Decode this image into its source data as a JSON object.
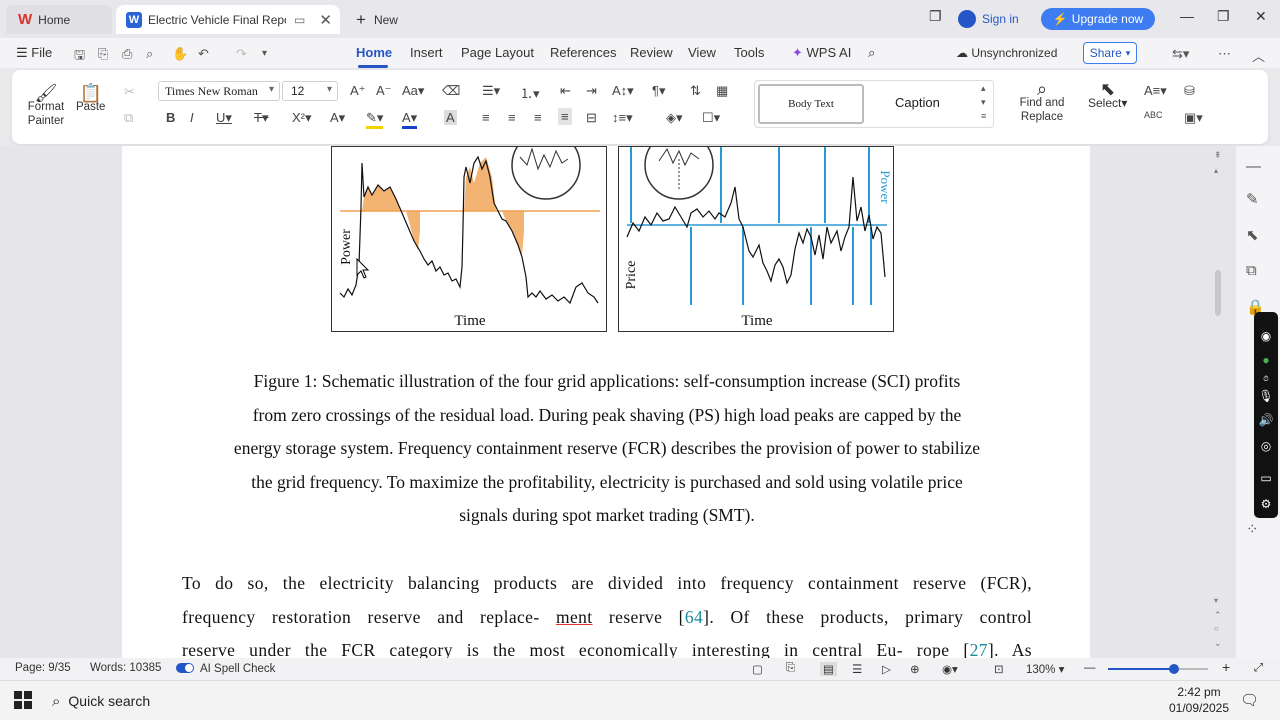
{
  "tabs": {
    "home": "Home",
    "document": "Electric Vehicle Final Report...",
    "new": "New"
  },
  "titlebar": {
    "sign_in": "Sign in",
    "upgrade": "Upgrade now"
  },
  "menu": {
    "file": "File",
    "items": [
      "Home",
      "Insert",
      "Page Layout",
      "References",
      "Review",
      "View",
      "Tools"
    ],
    "wps_ai": "WPS AI",
    "sync_status": "Unsynchronized",
    "share": "Share"
  },
  "ribbon": {
    "format_painter": "Format Painter",
    "paste": "Paste",
    "font_name": "Times New Roman",
    "font_size": "12",
    "styles": {
      "body_text": "Body Text",
      "caption": "Caption"
    },
    "find_replace": "Find and Replace",
    "select": "Select"
  },
  "figure": {
    "left_ylabel": "Power",
    "left_xlabel": "Time",
    "right_ylabel": "Price",
    "right_xlabel": "Time",
    "right_corner_label": "Power"
  },
  "document": {
    "caption_lines": [
      "Figure 1: Schematic illustration of the four grid applications: self-consumption increase (SCI) profits",
      "from zero crossings of the residual load. During peak shaving (PS) high load peaks are capped by the",
      "energy storage system. Frequency containment reserve (FCR) describes the provision of power to stabilize",
      "the grid frequency. To maximize the profitability, electricity is purchased and sold using volatile price",
      "signals during spot market trading (SMT)."
    ],
    "para_line1": "To do so, the electricity balancing products are divided into frequency containment reserve (FCR),",
    "para_line2_a": "frequency restoration reserve and replace-",
    "para_line2_b": "ment",
    "para_line2_c": "reserve [",
    "para_line2_ref": "64",
    "para_line2_d": "]. Of these products, primary control",
    "para_line3_a": "reserve under  the FCR category is the most economically interesting in central Eu- rope [",
    "para_line3_ref": "27",
    "para_line3_b": "]. As"
  },
  "statusbar": {
    "page": "Page: 9/35",
    "words": "Words: 10385",
    "spell": "AI Spell Check",
    "zoom": "130%"
  },
  "taskbar": {
    "search": "Quick search",
    "time": "2:42 pm",
    "date": "01/09/2025"
  },
  "colors": {
    "accent": "#2457c5",
    "upgrade": "#3d7cf1",
    "orange_fill": "#f0a050",
    "price_lines": "#2a9ad6"
  }
}
